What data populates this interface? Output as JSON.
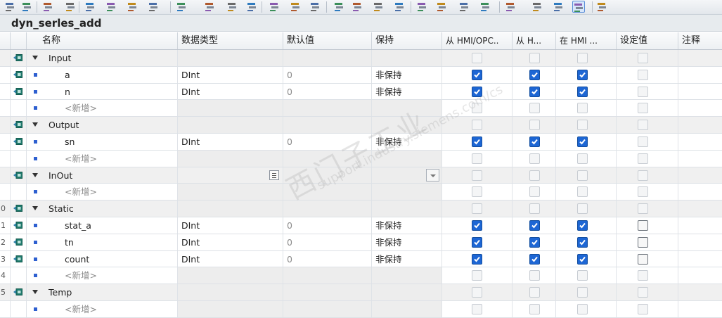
{
  "block": {
    "title": "dyn_serles_add"
  },
  "headers": {
    "name": "名称",
    "datatype": "数据类型",
    "default": "默认值",
    "retain": "保持",
    "hmi_opc": "从 HMI/OPC..",
    "hmi2": "从 H...",
    "hmi3": "在 HMI ...",
    "setpoint": "设定值",
    "comment": "注释"
  },
  "colors": {
    "check_on": "#1d66d4",
    "port_icon": "#1f7a6c",
    "row_marker": "#2d5fd0",
    "section_bg": "#f0f0f0"
  },
  "icons": {
    "row_interface": "interface-port-icon",
    "expand": "triangle-down-icon",
    "variable": "variable-square-icon",
    "browse": "browse-ellipsis-icon",
    "dropdown": "chevron-down-icon"
  },
  "rows": [
    {
      "num": "",
      "kind": "section",
      "port": true,
      "name": "Input",
      "datatype": "",
      "default": "",
      "retain": "",
      "checks": [
        "off",
        "off",
        "off",
        "off"
      ]
    },
    {
      "num": "",
      "kind": "var",
      "port": true,
      "name": "a",
      "datatype": "DInt",
      "default": "0",
      "retain": "非保持",
      "checks": [
        "on",
        "on",
        "on",
        "off"
      ]
    },
    {
      "num": "",
      "kind": "var",
      "port": true,
      "name": "n",
      "datatype": "DInt",
      "default": "0",
      "retain": "非保持",
      "checks": [
        "on",
        "on",
        "on",
        "off"
      ]
    },
    {
      "num": "",
      "kind": "add",
      "port": false,
      "name": "<新增>",
      "datatype": "",
      "default": "",
      "retain": "",
      "checks": [
        "off",
        "off",
        "off",
        "off"
      ]
    },
    {
      "num": "",
      "kind": "section",
      "port": true,
      "name": "Output",
      "datatype": "",
      "default": "",
      "retain": "",
      "checks": [
        "off",
        "off",
        "off",
        "off"
      ]
    },
    {
      "num": "",
      "kind": "var",
      "port": true,
      "name": "sn",
      "datatype": "DInt",
      "default": "0",
      "retain": "非保持",
      "checks": [
        "on",
        "on",
        "on",
        "off"
      ]
    },
    {
      "num": "",
      "kind": "add",
      "port": false,
      "name": "<新增>",
      "datatype": "",
      "default": "",
      "retain": "",
      "checks": [
        "off",
        "off",
        "off",
        "off"
      ]
    },
    {
      "num": "",
      "kind": "section",
      "port": true,
      "name": "InOut",
      "datatype": "",
      "default": "",
      "retain": "",
      "checks": [
        "off",
        "off",
        "off",
        "off"
      ],
      "editing": true
    },
    {
      "num": "",
      "kind": "add",
      "port": false,
      "name": "<新增>",
      "datatype": "",
      "default": "",
      "retain": "",
      "checks": [
        "off",
        "off",
        "off",
        "off"
      ]
    },
    {
      "num": "0",
      "kind": "section",
      "port": true,
      "name": "Static",
      "datatype": "",
      "default": "",
      "retain": "",
      "checks": [
        "off",
        "off",
        "off",
        "off"
      ]
    },
    {
      "num": "1",
      "kind": "var",
      "port": true,
      "name": "stat_a",
      "datatype": "DInt",
      "default": "0",
      "retain": "非保持",
      "checks": [
        "on",
        "on",
        "on",
        "dark"
      ]
    },
    {
      "num": "2",
      "kind": "var",
      "port": true,
      "name": "tn",
      "datatype": "DInt",
      "default": "0",
      "retain": "非保持",
      "checks": [
        "on",
        "on",
        "on",
        "dark"
      ]
    },
    {
      "num": "3",
      "kind": "var",
      "port": true,
      "name": "count",
      "datatype": "DInt",
      "default": "0",
      "retain": "非保持",
      "checks": [
        "on",
        "on",
        "on",
        "dark"
      ]
    },
    {
      "num": "4",
      "kind": "add",
      "port": false,
      "name": "<新增>",
      "datatype": "",
      "default": "",
      "retain": "",
      "checks": [
        "off",
        "off",
        "off",
        "off"
      ]
    },
    {
      "num": "5",
      "kind": "section",
      "port": true,
      "name": "Temp",
      "datatype": "",
      "default": "",
      "retain": "",
      "checks": [
        "off",
        "off",
        "off",
        "off"
      ]
    },
    {
      "num": "",
      "kind": "add",
      "port": false,
      "name": "<新增>",
      "datatype": "",
      "default": "",
      "retain": "",
      "checks": [
        "off",
        "off",
        "off",
        "off"
      ]
    }
  ],
  "watermark": {
    "line1": "西门子工业",
    "line2": "support.industry.siemens.com/cs"
  }
}
